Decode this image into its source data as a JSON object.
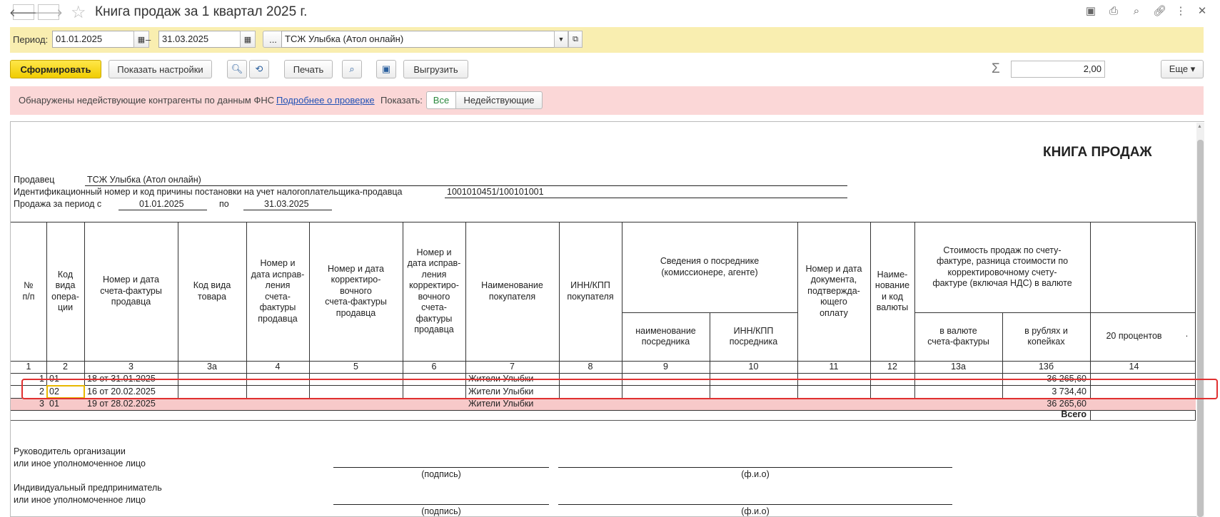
{
  "window": {
    "title": "Книга продаж за 1 квартал 2025 г."
  },
  "filter": {
    "period_label": "Период:",
    "date_from": "01.01.2025",
    "dash": "–",
    "date_to": "31.03.2025",
    "more_btn": "...",
    "org": "ТСЖ Улыбка (Атол онлайн)"
  },
  "toolbar": {
    "generate": "Сформировать",
    "show_settings": "Показать настройки",
    "print": "Печать",
    "export": "Выгрузить",
    "sum_value": "2,00",
    "more": "Еще ▾"
  },
  "warning": {
    "text": "Обнаружены недействующие контрагенты по данным ФНС",
    "link": "Подробнее о проверке",
    "show_label": "Показать:",
    "all": "Все",
    "inactive": "Недействующие"
  },
  "report": {
    "title": "КНИГА ПРОДАЖ",
    "seller_label": "Продавец",
    "seller": "ТСЖ Улыбка (Атол онлайн)",
    "inn_label": "Идентификационный номер и код причины постановки на учет налогоплательщика-продавца",
    "inn": "1001010451/100101001",
    "period_label": "Продажа за период с",
    "period_from": "01.01.2025",
    "period_to_label": "по",
    "period_to": "31.03.2025",
    "headers": {
      "h1": "№\nп/п",
      "h2": "Код\nвида\nопера-\nции",
      "h3": "Номер и дата\nсчета-фактуры\nпродавца",
      "h3a": "Код вида\nтовара",
      "h4": "Номер и\nдата исправ-\nления\nсчета-\nфактуры\nпродавца",
      "h5": "Номер и дата\nкорректиро-\nвочного\nсчета-фактуры\nпродавца",
      "h6": "Номер и\nдата исправ-\nления\nкорректиро-\nвочного\nсчета-\nфактуры\nпродавца",
      "h7": "Наименование\nпокупателя",
      "h8": "ИНН/КПП\nпокупателя",
      "h9_10": "Сведения о посреднике\n(комиссионере, агенте)",
      "h9": "наименование\nпосредника",
      "h10": "ИНН/КПП\nпосредника",
      "h11": "Номер и дата\nдокумента,\nподтвержда-\nющего\nоплату",
      "h12": "Наиме-\nнование\nи код\nвалюты",
      "h13": "Стоимость продаж по счету-\nфактуре, разница стоимости по\nкорректировочному счету-\nфактуре (включая НДС) в валюте",
      "h13a": "в валюте\nсчета-фактуры",
      "h13b": "в рублях и\nкопейках",
      "h14": "20 процентов",
      "h15": "·"
    },
    "colnums": [
      "1",
      "2",
      "3",
      "3а",
      "4",
      "5",
      "6",
      "7",
      "8",
      "9",
      "10",
      "11",
      "12",
      "13а",
      "13б",
      "14"
    ],
    "rows": [
      {
        "n": "1",
        "code": "01",
        "invoice": "18 от 31.01.2025",
        "buyer": "Жители Улыбки",
        "amount": "36 265,60"
      },
      {
        "n": "2",
        "code": "02",
        "invoice": "16 от 20.02.2025",
        "buyer": "Жители Улыбки",
        "amount": "3 734,40"
      },
      {
        "n": "3",
        "code": "01",
        "invoice": "19 от 28.02.2025",
        "buyer": "Жители Улыбки",
        "amount": "36 265,60"
      }
    ],
    "total_label": "Всего",
    "sig1_l1": "Руководитель организации",
    "sig1_l2": "или иное уполномоченное лицо",
    "sig2_l1": "Индивидуальный предприниматель",
    "sig2_l2": "или иное уполномоченное лицо",
    "sign_label": "(подпись)",
    "fio_label": "(ф.и.о)"
  },
  "colors": {
    "accent_yellow": "#f9eeb0",
    "warning_pink": "#fbd7d7",
    "highlight_red": "#e03030",
    "primary_btn": "#f5d400"
  }
}
